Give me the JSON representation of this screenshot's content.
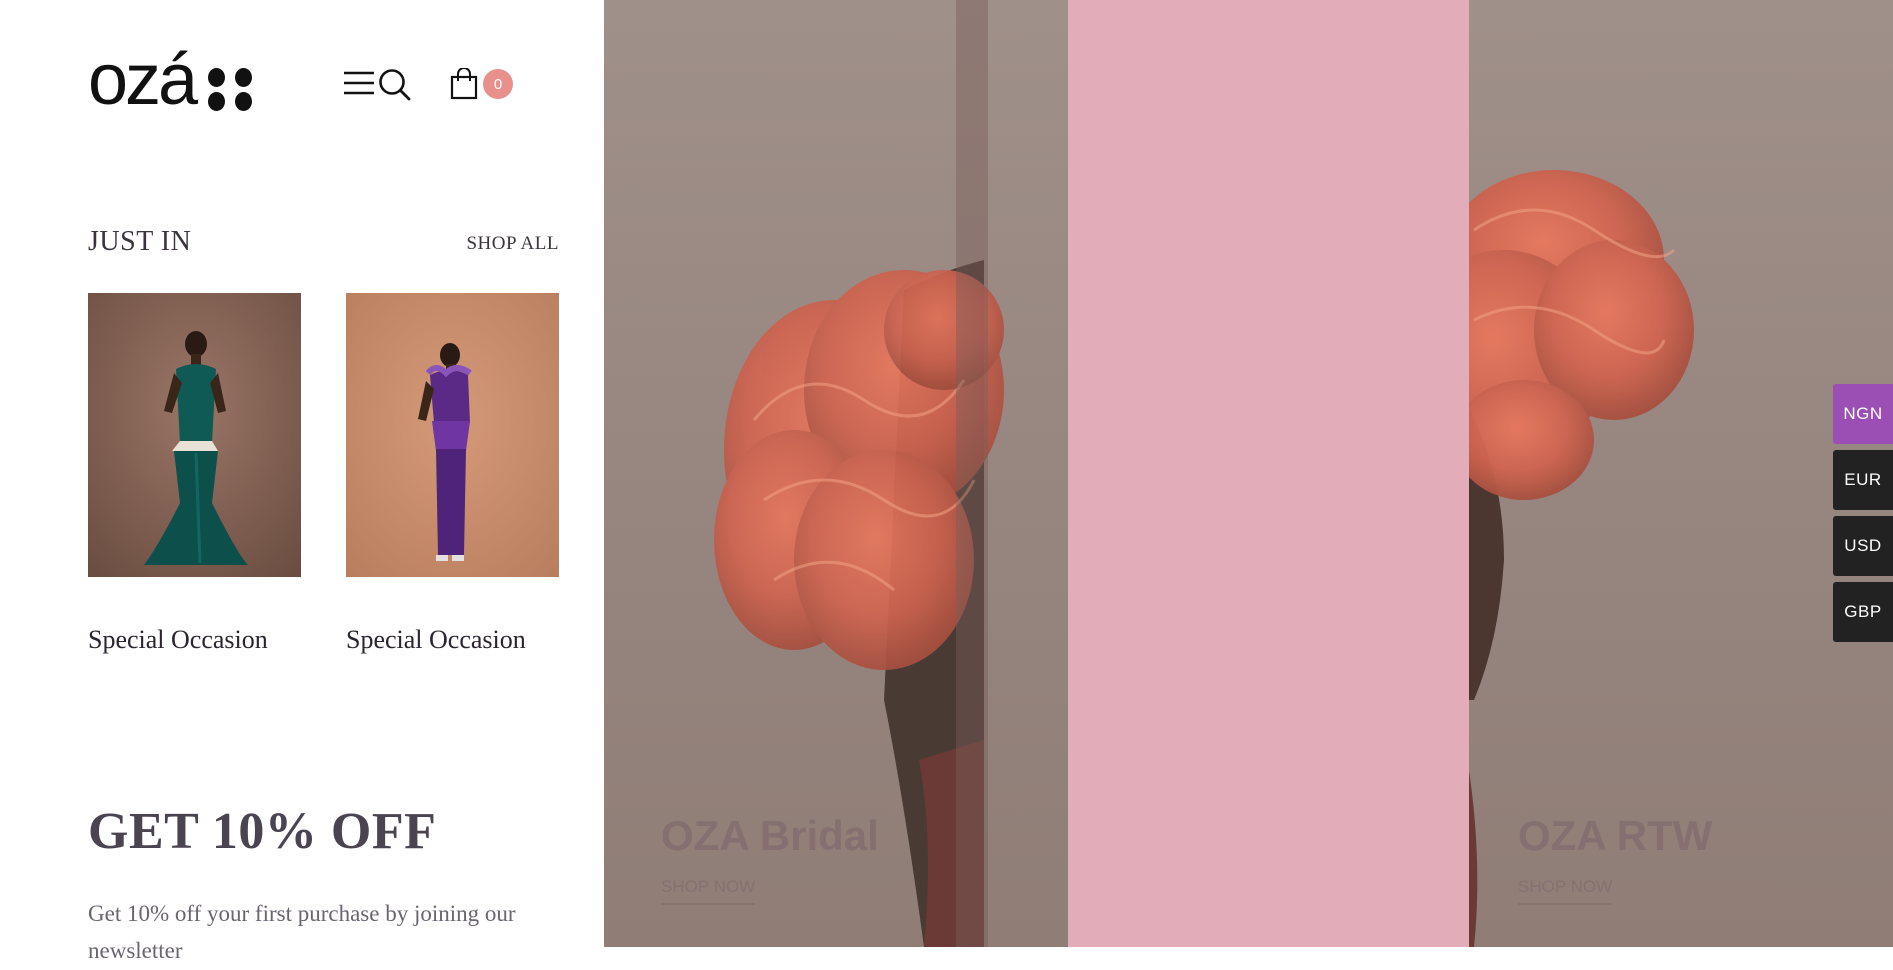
{
  "header": {
    "logo_text": "ozá",
    "menu_icon": "hamburger-menu-icon",
    "search_icon": "search-icon",
    "cart_icon": "shopping-bag-icon",
    "cart_count": "0",
    "cart_badge_color": "#e9908c"
  },
  "just_in": {
    "heading": "JUST IN",
    "shop_all_label": "SHOP ALL",
    "products": [
      {
        "name": "Special Occasion",
        "dress_color": "#0f5a55"
      },
      {
        "name": "Special Occasion",
        "dress_color": "#5b2a86"
      }
    ]
  },
  "promo": {
    "title": "GET 10% OFF",
    "text": "Get 10% off your first purchase by joining our newsletter"
  },
  "hero": {
    "panels": [
      {
        "title": "OZA Bridal",
        "link": "SHOP NOW"
      },
      {
        "title": "OZA RTW",
        "link": "SHOP NOW"
      }
    ],
    "accent_color": "#e3acb9"
  },
  "currencies": [
    {
      "code": "NGN",
      "active": true,
      "color": "#9b4fb5"
    },
    {
      "code": "EUR",
      "active": false,
      "color": "#222222"
    },
    {
      "code": "USD",
      "active": false,
      "color": "#222222"
    },
    {
      "code": "GBP",
      "active": false,
      "color": "#222222"
    }
  ]
}
